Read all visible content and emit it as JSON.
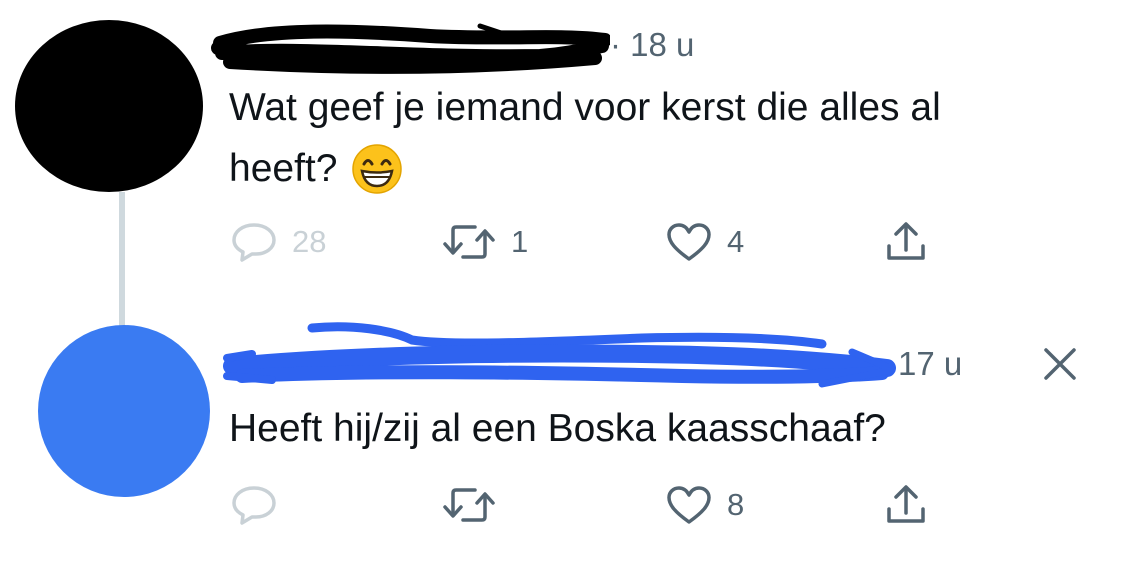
{
  "colors": {
    "avatar_1": "#000000",
    "avatar_2": "#3a7bf2",
    "scribble_1": "#000000",
    "scribble_2": "#2f63f0",
    "meta_text": "#536471",
    "body_text": "#0f1419",
    "thread_line": "#cfd9de"
  },
  "tweet1": {
    "time": "· 18 u",
    "text_line1": "Wat geef je iemand voor kerst die alles al",
    "text_line2": "heeft?",
    "emoji": "😁",
    "actions": {
      "reply": {
        "icon": "reply-icon",
        "count": "28"
      },
      "retweet": {
        "icon": "retweet-icon",
        "count": "1"
      },
      "like": {
        "icon": "heart-icon",
        "count": "4"
      },
      "share": {
        "icon": "share-icon"
      }
    }
  },
  "tweet2": {
    "time": "17 u",
    "text": "Heeft hij/zij al een Boska kaasschaaf?",
    "actions": {
      "reply": {
        "icon": "reply-icon"
      },
      "retweet": {
        "icon": "retweet-icon"
      },
      "like": {
        "icon": "heart-icon",
        "count": "8"
      },
      "share": {
        "icon": "share-icon"
      }
    },
    "dismiss_icon": "close-icon"
  }
}
